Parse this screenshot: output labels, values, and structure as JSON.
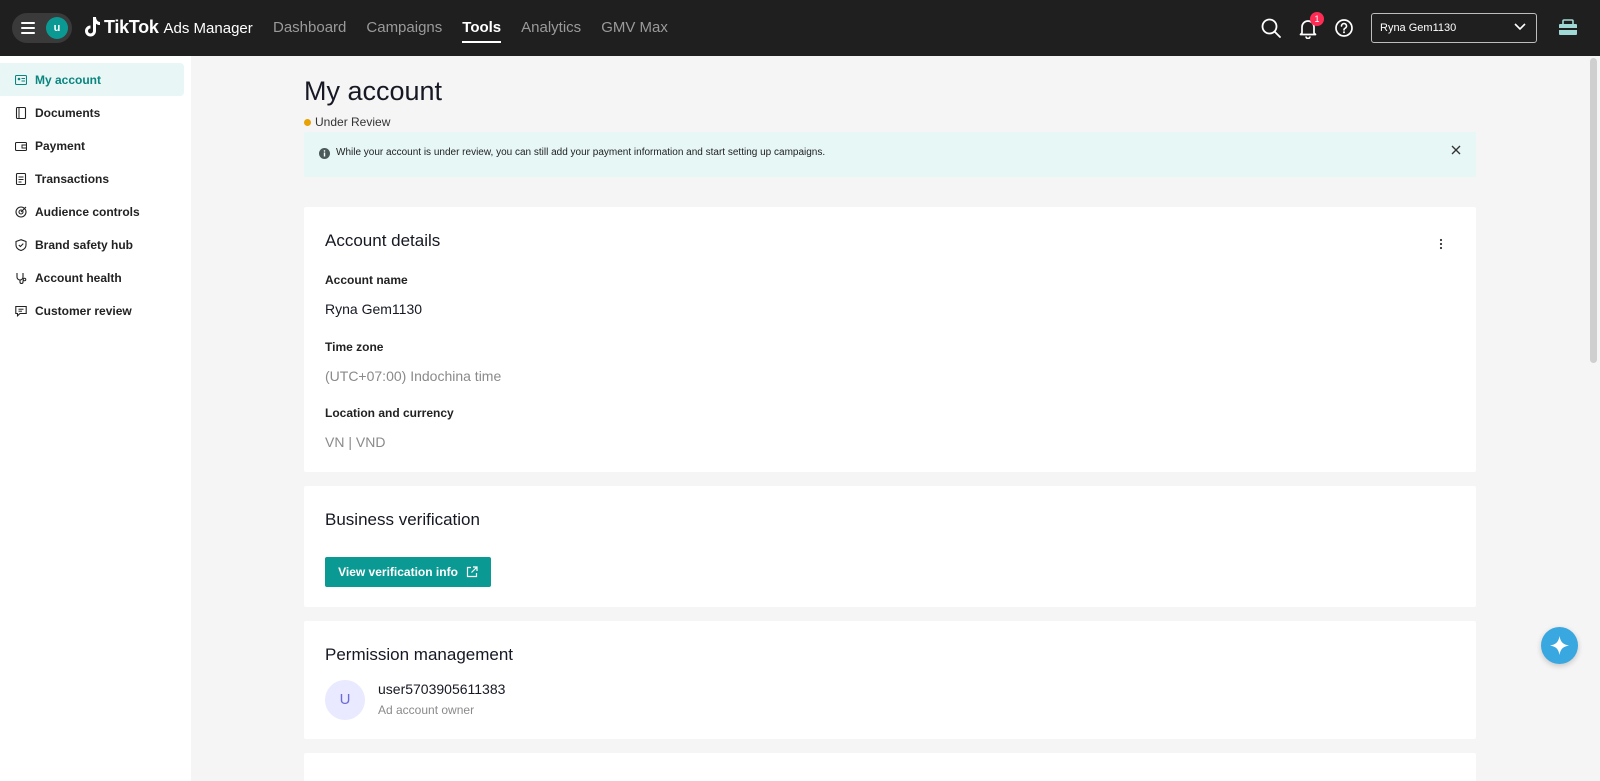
{
  "app": {
    "brand": "TikTok",
    "product": "Ads Manager",
    "avatar_initial": "u"
  },
  "nav": {
    "items": [
      {
        "label": "Dashboard",
        "active": false
      },
      {
        "label": "Campaigns",
        "active": false
      },
      {
        "label": "Tools",
        "active": true
      },
      {
        "label": "Analytics",
        "active": false
      },
      {
        "label": "GMV Max",
        "active": false
      }
    ]
  },
  "header": {
    "notification_count": "1",
    "account_selector": "Ryna Gem1130"
  },
  "sidebar": {
    "items": [
      {
        "label": "My account",
        "icon": "id-card-icon",
        "active": true
      },
      {
        "label": "Documents",
        "icon": "document-icon",
        "active": false
      },
      {
        "label": "Payment",
        "icon": "wallet-icon",
        "active": false
      },
      {
        "label": "Transactions",
        "icon": "receipt-icon",
        "active": false
      },
      {
        "label": "Audience controls",
        "icon": "target-icon",
        "active": false
      },
      {
        "label": "Brand safety hub",
        "icon": "shield-icon",
        "active": false
      },
      {
        "label": "Account health",
        "icon": "stethoscope-icon",
        "active": false
      },
      {
        "label": "Customer review",
        "icon": "chat-icon",
        "active": false
      }
    ]
  },
  "main": {
    "title": "My account",
    "status": "Under Review",
    "banner_text": "While your account is under review, you can still add your payment information and start setting up campaigns.",
    "account_details": {
      "title": "Account details",
      "account_name_label": "Account name",
      "account_name_value": "Ryna Gem1130",
      "time_zone_label": "Time zone",
      "time_zone_value": "(UTC+07:00) Indochina time",
      "location_label": "Location and currency",
      "location_value": "VN | VND"
    },
    "business_verification": {
      "title": "Business verification",
      "button_label": "View verification info"
    },
    "permission_management": {
      "title": "Permission management",
      "user_initial": "U",
      "user_name": "user5703905611383",
      "user_role": "Ad account owner"
    }
  },
  "colors": {
    "accent": "#0b9a93",
    "topbar": "#1f1f1f",
    "status_pending": "#e8a202",
    "badge": "#fe2c55"
  }
}
